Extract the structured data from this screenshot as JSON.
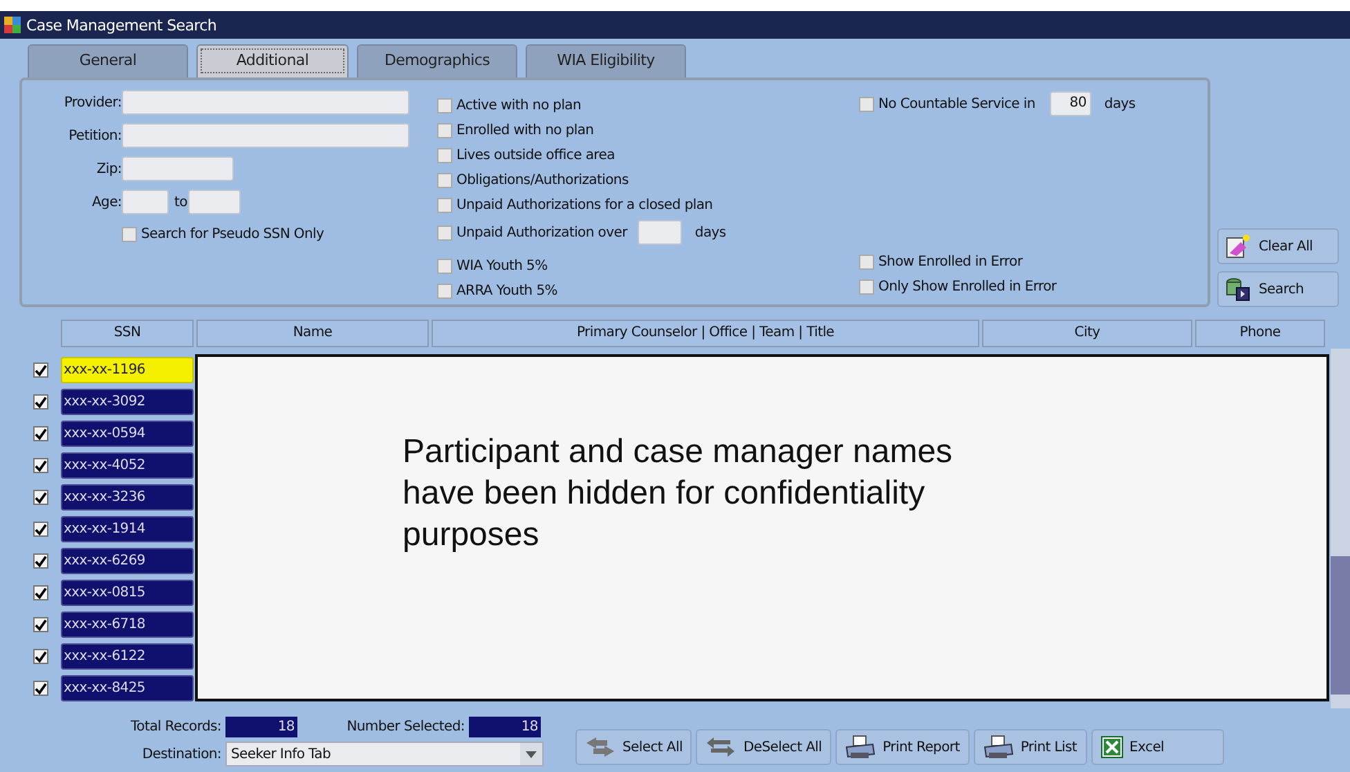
{
  "window": {
    "title": "Case Management Search"
  },
  "tabs": [
    {
      "label": "General",
      "selected": false
    },
    {
      "label": "Additional",
      "selected": true
    },
    {
      "label": "Demographics",
      "selected": false
    },
    {
      "label": "WIA Eligibility",
      "selected": false
    }
  ],
  "form": {
    "fields": [
      {
        "label": "Provider:",
        "kind": "wide"
      },
      {
        "label": "Petition:",
        "kind": "wide"
      },
      {
        "label": "Zip:",
        "kind": "short"
      },
      {
        "label": "Age:",
        "kind": "range",
        "to_label": "to"
      }
    ],
    "pseudo_ssn": {
      "label": "Search for Pseudo SSN Only",
      "checked": false
    },
    "filters": [
      {
        "label": "Active with no plan",
        "checked": false,
        "kind": "plain"
      },
      {
        "label": "Enrolled with no plan",
        "checked": false,
        "kind": "plain"
      },
      {
        "label": "Lives outside office area",
        "checked": false,
        "kind": "plain"
      },
      {
        "label": "Obligations/Authorizations",
        "checked": false,
        "kind": "plain"
      },
      {
        "label": "Unpaid Authorizations for a closed plan",
        "checked": false,
        "kind": "plain"
      },
      {
        "label": "Unpaid Authorization over",
        "checked": false,
        "kind": "days",
        "unit": "days"
      }
    ],
    "youth_filters": [
      {
        "label": "WIA Youth 5%",
        "checked": false
      },
      {
        "label": "ARRA Youth 5%",
        "checked": false
      }
    ],
    "no_service": {
      "label": "No Countable Service in",
      "checked": false,
      "value": "80",
      "unit": "days"
    },
    "error_filters": [
      {
        "label": "Show Enrolled in Error",
        "checked": false
      },
      {
        "label": "Only Show Enrolled in Error",
        "checked": false
      }
    ]
  },
  "side_buttons": [
    {
      "label": "Clear All",
      "kind": "clear"
    },
    {
      "label": "Search",
      "kind": "search"
    }
  ],
  "table": {
    "columns": [
      "SSN",
      "Name",
      "Primary Counselor | Office | Team | Title",
      "City",
      "Phone"
    ],
    "rows": [
      {
        "checked": true,
        "ssn": "xxx-xx-1196",
        "selected": true
      },
      {
        "checked": true,
        "ssn": "xxx-xx-3092",
        "selected": false
      },
      {
        "checked": true,
        "ssn": "xxx-xx-0594",
        "selected": false
      },
      {
        "checked": true,
        "ssn": "xxx-xx-4052",
        "selected": false
      },
      {
        "checked": true,
        "ssn": "xxx-xx-3236",
        "selected": false
      },
      {
        "checked": true,
        "ssn": "xxx-xx-1914",
        "selected": false
      },
      {
        "checked": true,
        "ssn": "xxx-xx-6269",
        "selected": false
      },
      {
        "checked": true,
        "ssn": "xxx-xx-0815",
        "selected": false
      },
      {
        "checked": true,
        "ssn": "xxx-xx-6718",
        "selected": false
      },
      {
        "checked": true,
        "ssn": "xxx-xx-6122",
        "selected": false
      },
      {
        "checked": true,
        "ssn": "xxx-xx-8425",
        "selected": false
      }
    ]
  },
  "overlay_note": "Participant and case manager names have been hidden for confidentiality purposes",
  "footer": {
    "total_records": {
      "label": "Total Records:",
      "value": "18"
    },
    "number_selected": {
      "label": "Number Selected:",
      "value": "18"
    },
    "destination": {
      "label": "Destination:",
      "value": "Seeker Info Tab"
    },
    "buttons": [
      {
        "label": "Select All",
        "kind": "select"
      },
      {
        "label": "DeSelect All",
        "kind": "deselect"
      },
      {
        "label": "Print Report",
        "kind": "print"
      },
      {
        "label": "Print List",
        "kind": "print"
      },
      {
        "label": "Excel",
        "kind": "excel"
      }
    ]
  }
}
